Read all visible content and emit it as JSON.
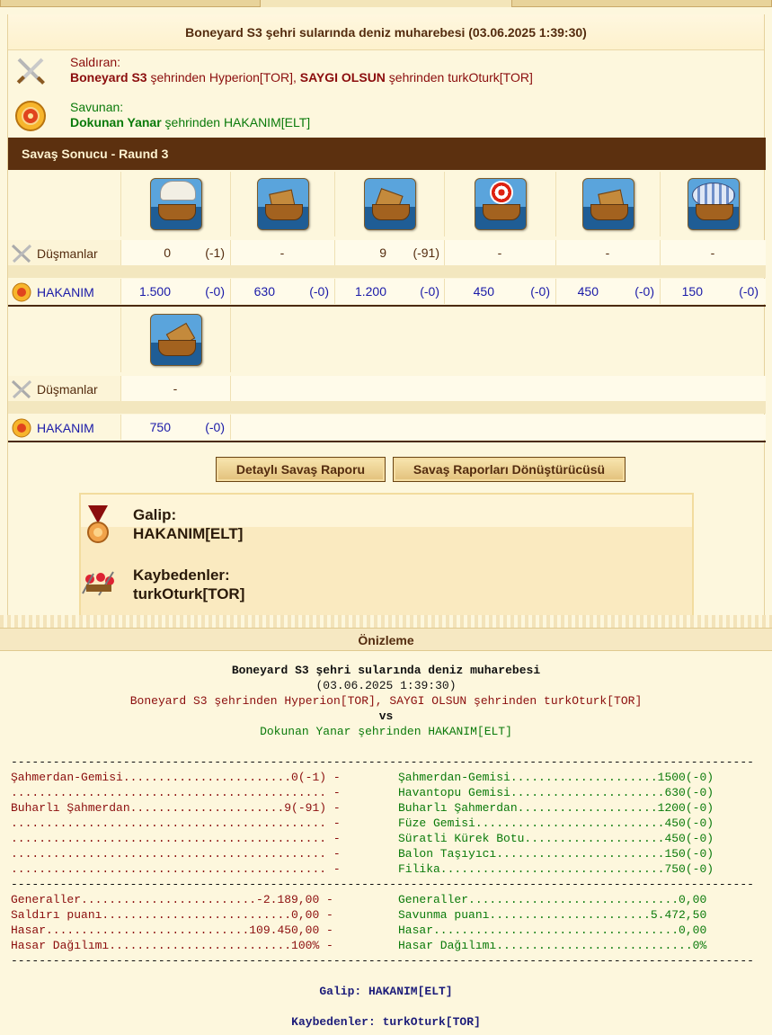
{
  "report": {
    "title": "Boneyard S3 şehri sularında deniz muharebesi (03.06.2025 1:39:30)",
    "attacker_label": "Saldıran:",
    "attacker_city1": "Boneyard S3",
    "attacker_mid1": " şehrinden Hyperion[TOR], ",
    "attacker_city2": "SAYGI OLSUN",
    "attacker_mid2": " şehrinden turkOturk[TOR]",
    "defender_label": "Savunan:",
    "defender_city": "Dokunan Yanar",
    "defender_mid": " şehrinden HAKANIM[ELT]",
    "section_title": "Savaş Sonucu - Raund 3",
    "enemies_label": "Düşmanlar",
    "defender_row_label": "HAKANIM",
    "row1_units": [
      {
        "icon": "ram-ship-icon",
        "enemy": "0",
        "enemy_loss": "(-1)",
        "def": "1.500",
        "def_loss": "(-0)"
      },
      {
        "icon": "fire-ship-icon",
        "enemy": "-",
        "enemy_loss": "",
        "def": "630",
        "def_loss": "(-0)"
      },
      {
        "icon": "steam-ram-icon",
        "enemy": "9",
        "enemy_loss": "(-91)",
        "def": "1.200",
        "def_loss": "(-0)"
      },
      {
        "icon": "rocket-ship-icon",
        "enemy": "-",
        "enemy_loss": "",
        "def": "450",
        "def_loss": "(-0)"
      },
      {
        "icon": "paddle-speedboat-icon",
        "enemy": "-",
        "enemy_loss": "",
        "def": "450",
        "def_loss": "(-0)"
      },
      {
        "icon": "balloon-carrier-icon",
        "enemy": "-",
        "enemy_loss": "",
        "def": "150",
        "def_loss": "(-0)"
      }
    ],
    "row2_units": [
      {
        "icon": "tender-ship-icon",
        "enemy": "-",
        "enemy_loss": "",
        "def": "750",
        "def_loss": "(-0)"
      }
    ],
    "btn_detail": "Detaylı Savaş Raporu",
    "btn_converter": "Savaş Raporları Dönüştürücüsü",
    "winner_label": "Galip:",
    "winner": "HAKANIM[ELT]",
    "losers_label": "Kaybedenler:",
    "losers": "turkOturk[TOR]"
  },
  "preview": {
    "header": "Önizleme",
    "title": "Boneyard S3 şehri sularında deniz muharebesi",
    "date": "(03.06.2025 1:39:30)",
    "attackers": "Boneyard S3 şehrinden Hyperion[TOR], SAYGI OLSUN şehrinden turkOturk[TOR]",
    "vs": "vs",
    "defenders": "Dokunan Yanar şehrinden HAKANIM[ELT]",
    "divider": "----------------------------------------------------------------------------------------------------------",
    "unit_lines_left": [
      "Şahmerdan-Gemisi........................0(-1) -",
      "............................................. -",
      "Buharlı Şahmerdan......................9(-91) -",
      "............................................. -",
      "............................................. -",
      "............................................. -",
      "............................................. -"
    ],
    "unit_lines_right": [
      "Şahmerdan-Gemisi.....................1500(-0)",
      "Havantopu Gemisi......................630(-0)",
      "Buharlı Şahmerdan....................1200(-0)",
      "Füze Gemisi...........................450(-0)",
      "Süratli Kürek Botu....................450(-0)",
      "Balon Taşıyıcı........................150(-0)",
      "Filika................................750(-0)"
    ],
    "stat_lines_left": [
      "Generaller.........................-2.189,00 -",
      "Saldırı puanı...........................0,00 -",
      "Hasar.............................109.450,00 -",
      "Hasar Dağılımı..........................100% -"
    ],
    "stat_lines_right": [
      "Generaller..............................0,00",
      "Savunma puanı.......................5.472,50",
      "Hasar...................................0,00",
      "Hasar Dağılımı............................0%"
    ],
    "winner_line": "Galip: HAKANIM[ELT]",
    "losers_line": "Kaybedenler: turkOturk[TOR]"
  }
}
